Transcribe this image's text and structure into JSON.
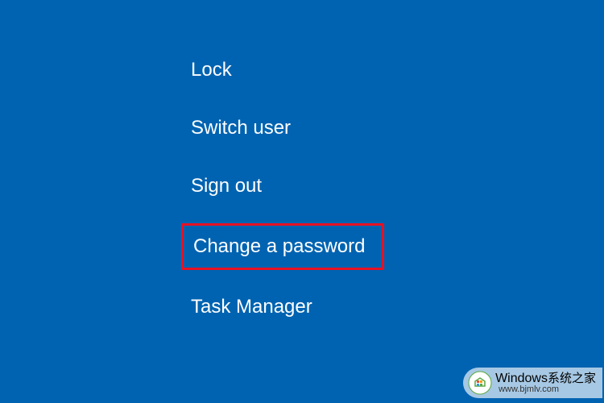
{
  "security_menu": {
    "items": [
      {
        "id": "lock",
        "label": "Lock",
        "highlighted": false
      },
      {
        "id": "switch-user",
        "label": "Switch user",
        "highlighted": false
      },
      {
        "id": "sign-out",
        "label": "Sign out",
        "highlighted": false
      },
      {
        "id": "change-password",
        "label": "Change a password",
        "highlighted": true
      },
      {
        "id": "task-manager",
        "label": "Task Manager",
        "highlighted": false
      }
    ]
  },
  "watermark": {
    "brand": "Windows",
    "brand_cn": "系统之家",
    "url": "www.bjmlv.com"
  },
  "colors": {
    "background": "#0063B1",
    "text": "#ffffff",
    "highlight_border": "#E81123"
  }
}
